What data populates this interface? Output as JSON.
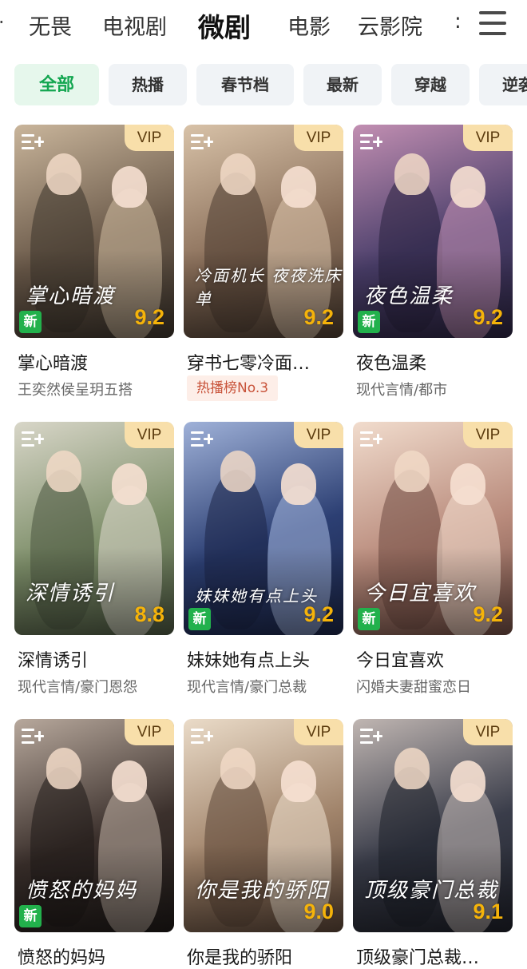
{
  "nav": {
    "edge": "·",
    "tabs": [
      "无畏",
      "电视剧",
      "微剧",
      "电影",
      "云影院"
    ],
    "more": ":"
  },
  "chips": [
    "全部",
    "热播",
    "春节档",
    "最新",
    "穿越",
    "逆袭"
  ],
  "vip_label": "VIP",
  "new_label": "新",
  "cards": [
    {
      "title": "掌心暗渡",
      "sub": "王奕然侯呈玥五搭",
      "score": "9.2",
      "new": true,
      "poster_text": "掌心暗渡",
      "colors": [
        "#6b5a4a",
        "#c9b59b",
        "#3c342c"
      ]
    },
    {
      "title": "穿书七零冷面…",
      "hot": "热播榜No.3",
      "score": "9.2",
      "new": false,
      "poster_text": "冷面机长 夜夜洗床单",
      "colors": [
        "#8a6f5a",
        "#d8c2a8",
        "#4a3b30"
      ]
    },
    {
      "title": "夜色温柔",
      "sub": "现代言情/都市",
      "score": "9.2",
      "new": true,
      "poster_text": "夜色温柔",
      "colors": [
        "#4b3f6b",
        "#c28fb2",
        "#2a2340"
      ]
    },
    {
      "title": "深情诱引",
      "sub": "现代言情/豪门恩怨",
      "score": "8.8",
      "new": false,
      "poster_text": "深情诱引",
      "colors": [
        "#7e8f6a",
        "#d8d6c8",
        "#4b5640"
      ]
    },
    {
      "title": "妹妹她有点上头",
      "sub": "现代言情/豪门总裁",
      "score": "9.2",
      "new": true,
      "poster_text": "妹妹她有点上头",
      "colors": [
        "#2c3f73",
        "#9fb1d8",
        "#1b2547"
      ]
    },
    {
      "title": "今日宜喜欢",
      "sub": "闪婚夫妻甜蜜恋日",
      "score": "9.2",
      "new": true,
      "poster_text": "今日宜喜欢",
      "colors": [
        "#b98b7c",
        "#f1dccd",
        "#6f4b42"
      ]
    },
    {
      "title": "愤怒的妈妈",
      "sub": "",
      "score": "",
      "new": true,
      "poster_text": "愤怒的妈妈",
      "colors": [
        "#3b302c",
        "#b7a89c",
        "#1f1a18"
      ]
    },
    {
      "title": "你是我的骄阳",
      "sub": "",
      "score": "9.0",
      "new": false,
      "poster_text": "你是我的骄阳",
      "colors": [
        "#a0836a",
        "#eadbc8",
        "#5b4537"
      ]
    },
    {
      "title": "顶级豪门总裁…",
      "sub": "",
      "score": "9.1",
      "new": false,
      "poster_text": "顶级豪门总裁",
      "colors": [
        "#3a3d4a",
        "#c0b6b2",
        "#1e2029"
      ]
    }
  ]
}
